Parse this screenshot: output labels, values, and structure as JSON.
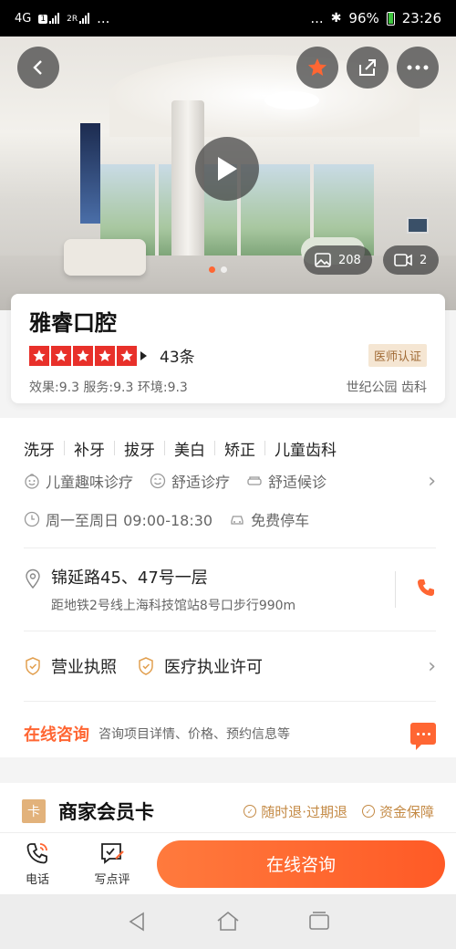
{
  "status_bar": {
    "network": "4G",
    "sim1": "1",
    "sim2": "2R",
    "more_left": "...",
    "more_right": "...",
    "battery": "96%",
    "time": "23:26"
  },
  "hero": {
    "photo_count": "208",
    "video_count": "2",
    "slides": 2,
    "active_slide": 0
  },
  "shop": {
    "name": "雅睿口腔",
    "stars": 5,
    "review_count": "43条",
    "badge": "医师认证",
    "scores": "效果:9.3 服务:9.3 环境:9.3",
    "region_category": "世纪公园 齿科"
  },
  "tags": [
    "洗牙",
    "补牙",
    "拔牙",
    "美白",
    "矫正",
    "儿童齿科"
  ],
  "features": [
    {
      "icon": "child-face-icon",
      "label": "儿童趣味诊疗"
    },
    {
      "icon": "smile-icon",
      "label": "舒适诊疗"
    },
    {
      "icon": "sofa-icon",
      "label": "舒适候诊"
    }
  ],
  "hours": "周一至周日 09:00-18:30",
  "parking": "免费停车",
  "address": {
    "main": "锦延路45、47号一层",
    "sub": "距地铁2号线上海科技馆站8号口步行990m"
  },
  "licenses": [
    "营业执照",
    "医疗执业许可"
  ],
  "consult": {
    "title": "在线咨询",
    "desc": "咨询项目详情、价格、预约信息等"
  },
  "member": {
    "icon_text": "卡",
    "title": "商家会员卡",
    "guarantees": [
      "随时退·过期退",
      "资金保障"
    ]
  },
  "actionbar": {
    "phone": "电话",
    "review": "写点评",
    "consult_button": "在线咨询"
  },
  "colors": {
    "accent": "#ff6633",
    "star": "#e8302a",
    "gold": "#c48a45"
  }
}
